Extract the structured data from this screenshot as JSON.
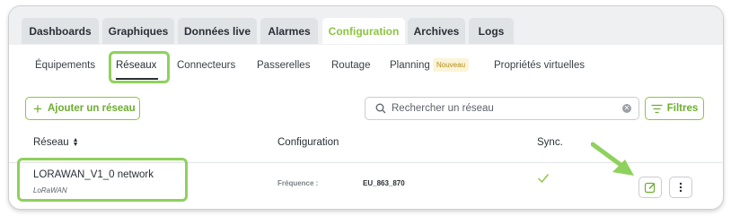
{
  "tabs": [
    {
      "label": "Dashboards"
    },
    {
      "label": "Graphiques"
    },
    {
      "label": "Données live"
    },
    {
      "label": "Alarmes"
    },
    {
      "label": "Configuration"
    },
    {
      "label": "Archives"
    },
    {
      "label": "Logs"
    }
  ],
  "active_tab": "Configuration",
  "subnav": [
    {
      "label": "Équipements"
    },
    {
      "label": "Réseaux"
    },
    {
      "label": "Connecteurs"
    },
    {
      "label": "Passerelles"
    },
    {
      "label": "Routage"
    },
    {
      "label": "Planning"
    },
    {
      "label": "Propriétés virtuelles"
    }
  ],
  "active_subnav": "Réseaux",
  "planning_badge": "Nouveau",
  "toolbar": {
    "add_label": "Ajouter un réseau",
    "search_placeholder": "Rechercher un réseau",
    "filter_label": "Filtres"
  },
  "table": {
    "headers": [
      "Réseau",
      "Configuration",
      "Sync."
    ],
    "rows": [
      {
        "name": "LORAWAN_V1_0 network",
        "type": "LoRaWAN",
        "config_label": "Fréquence :",
        "config_value": "EU_863_870",
        "synced": true
      }
    ]
  },
  "colors": {
    "accent": "#8cc540",
    "highlight": "#8ed15c",
    "text": "#2a2f36"
  }
}
